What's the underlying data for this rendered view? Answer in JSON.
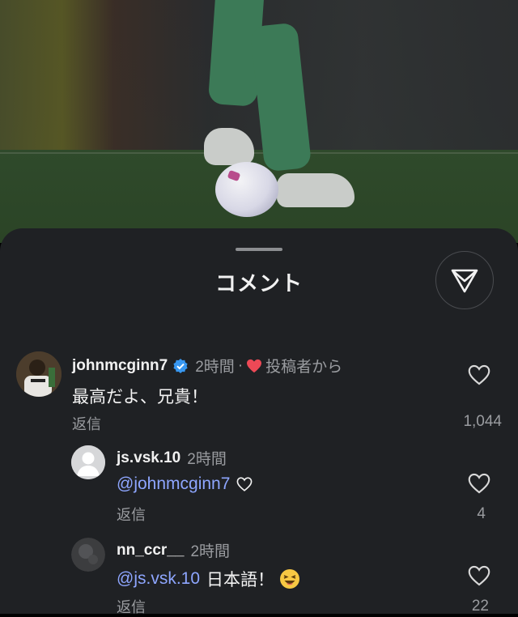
{
  "sheet": {
    "title": "コメント"
  },
  "comments": [
    {
      "username": "johnmcginn7",
      "verified": true,
      "time": "2時間",
      "separator": "·",
      "creator_badge": "投稿者から",
      "text": "最高だよ、兄貴！",
      "reply_label": "返信",
      "likes": "1,044"
    },
    {
      "username": "js.vsk.10",
      "time": "2時間",
      "mention": "@johnmcginn7",
      "text": "",
      "reply_label": "返信",
      "likes": "4"
    },
    {
      "username": "nn_ccr__",
      "time": "2時間",
      "mention": "@js.vsk.10",
      "text": "日本語！",
      "emoji": "😆",
      "reply_label": "返信",
      "likes": "22"
    }
  ],
  "colors": {
    "sheet": "#1f2124",
    "mention": "#8ea6ff",
    "verified": "#3897f0",
    "heart": "#ed4956"
  },
  "icons": [
    "send-icon",
    "verified-icon",
    "heart-icon",
    "like-icon",
    "white-heart-icon",
    "laughing-emoji"
  ]
}
